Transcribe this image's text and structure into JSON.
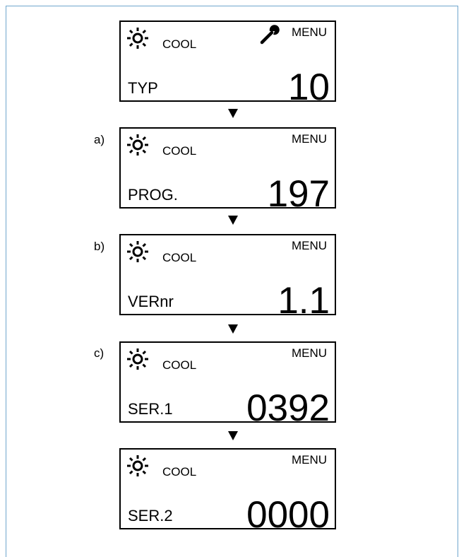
{
  "screens": [
    {
      "label": "",
      "mode": "COOL",
      "menu": "MENU",
      "param": "TYP",
      "value": "10",
      "icons": [
        "sun-icon",
        "wrench-icon"
      ]
    },
    {
      "label": "a)",
      "mode": "COOL",
      "menu": "MENU",
      "param": "PROG.",
      "value": "197",
      "icons": [
        "sun-icon"
      ]
    },
    {
      "label": "b)",
      "mode": "COOL",
      "menu": "MENU",
      "param": "VERnr",
      "value": "1.1",
      "icons": [
        "sun-icon"
      ]
    },
    {
      "label": "c)",
      "mode": "COOL",
      "menu": "MENU",
      "param": "SER.1",
      "value": "0392",
      "icons": [
        "sun-icon"
      ]
    },
    {
      "label": "",
      "mode": "COOL",
      "menu": "MENU",
      "param": "SER.2",
      "value": "0000",
      "icons": [
        "sun-icon"
      ]
    }
  ],
  "colors": {
    "frame_border": "#6fa6cd",
    "lcd_border": "#000000"
  }
}
